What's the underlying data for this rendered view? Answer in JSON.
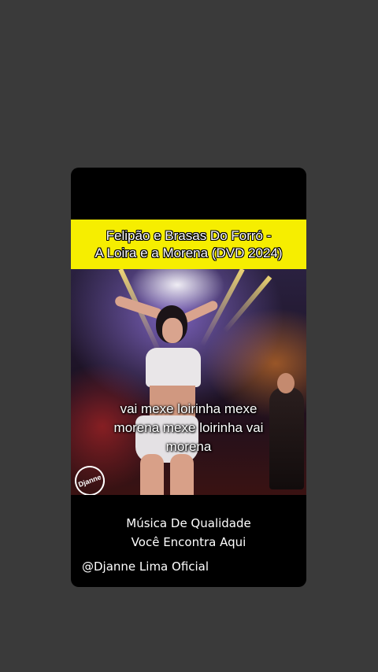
{
  "story": {
    "title_lines": [
      "Felipão e Brasas Do Forró -",
      "A Loira e a Morena (DVD 2024)"
    ],
    "lyrics_lines": [
      "vai mexe loirinha mexe",
      "morena mexe loirinha vai",
      "morena"
    ],
    "footer_lines": [
      "Música De Qualidade",
      "Você Encontra Aqui"
    ],
    "handle": "@Djanne Lima Oficial",
    "watermark": "Djanne"
  },
  "colors": {
    "page_background": "#3a3a3a",
    "card_background": "#000000",
    "title_banner": "#f6ee00",
    "text": "#ffffff"
  }
}
